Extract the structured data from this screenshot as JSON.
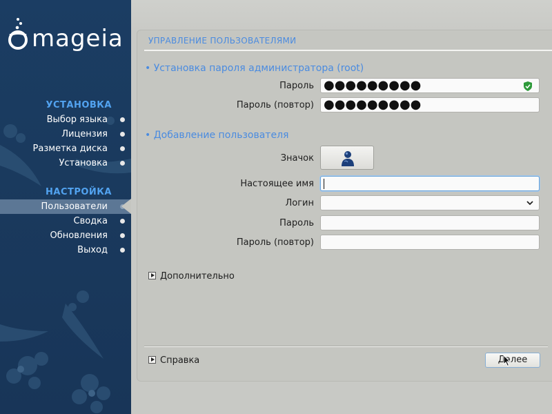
{
  "brand": {
    "logo_text": "mageia"
  },
  "sidebar": {
    "section_install": "УСТАНОВКА",
    "install_items": [
      {
        "label": "Выбор языка"
      },
      {
        "label": "Лицензия"
      },
      {
        "label": "Разметка диска"
      },
      {
        "label": "Установка"
      }
    ],
    "section_setup": "НАСТРОЙКА",
    "setup_items": [
      {
        "label": "Пользователи",
        "active": true
      },
      {
        "label": "Сводка"
      },
      {
        "label": "Обновления"
      },
      {
        "label": "Выход"
      }
    ]
  },
  "panel": {
    "title": "УПРАВЛЕНИЕ ПОЛЬЗОВАТЕЛЯМИ",
    "root_section": "• Установка пароля администратора (root)",
    "root_password_label": "Пароль",
    "root_password_value": "●●●●●●●●●",
    "root_password_repeat_label": "Пароль (повтор)",
    "root_password_repeat_value": "●●●●●●●●●",
    "user_section": "• Добавление пользователя",
    "icon_label": "Значок",
    "real_name_label": "Настоящее имя",
    "real_name_value": "",
    "login_label": "Логин",
    "login_value": "",
    "user_password_label": "Пароль",
    "user_password_value": "",
    "user_password_repeat_label": "Пароль (повтор)",
    "user_password_repeat_value": "",
    "advanced_label": "Дополнительно",
    "help_label": "Справка",
    "next_button": "Далее"
  },
  "colors": {
    "accent": "#4a8be0",
    "sidebar_bg": "#1a3a5e",
    "sidebar_heading": "#52a3f0",
    "panel_bg": "#c5c6c1",
    "strength_ok": "#2e9a3a"
  },
  "icons": {
    "password_strength": "shield-check-icon",
    "user_avatar": "user-avatar-icon",
    "login_dropdown": "chevron-down-icon",
    "expander": "triangle-right-icon"
  }
}
